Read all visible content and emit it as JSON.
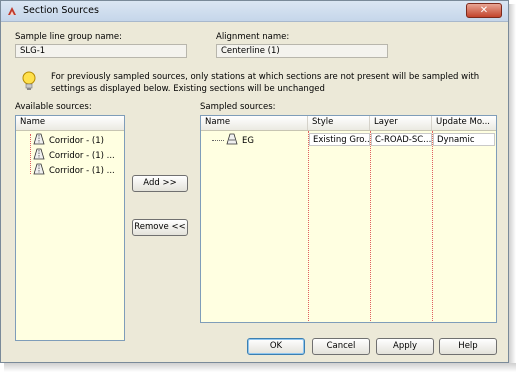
{
  "window": {
    "title": "Section Sources",
    "close_label": "✕"
  },
  "fields": {
    "sample_line_group_label": "Sample line group name:",
    "sample_line_group_value": "SLG-1",
    "alignment_label": "Alignment name:",
    "alignment_value": "Centerline (1)"
  },
  "info": {
    "text": "For previously sampled sources, only stations at which sections are not present will be sampled with settings as displayed below. Existing sections will be unchanged"
  },
  "available": {
    "label": "Available sources:",
    "column": "Name",
    "items": [
      "Corridor - (1)",
      "Corridor - (1) ...",
      "Corridor - (1) ..."
    ]
  },
  "sampled": {
    "label": "Sampled sources:",
    "columns": [
      "Name",
      "Style",
      "Layer",
      "Update Mo..."
    ],
    "rows": [
      {
        "name": "EG",
        "style": "Existing Gro...",
        "layer": "C-ROAD-SC...",
        "update": "Dynamic"
      }
    ]
  },
  "buttons": {
    "add": "Add >>",
    "remove": "Remove <<",
    "ok": "OK",
    "cancel": "Cancel",
    "apply": "Apply",
    "help": "Help"
  },
  "colors": {
    "list_background": "#ffffe1",
    "window_background": "#ece9d8",
    "close_button": "#c3442c"
  }
}
